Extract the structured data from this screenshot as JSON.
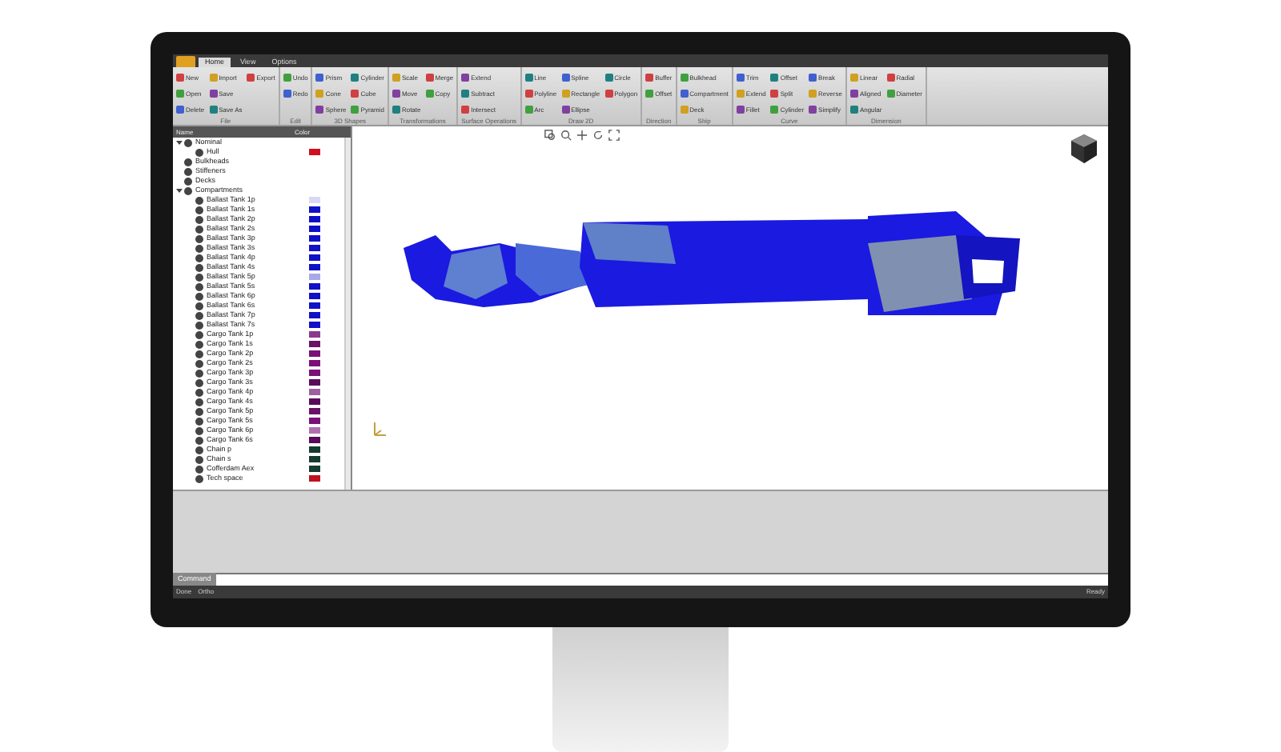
{
  "ribbon": {
    "tabs": [
      {
        "label": "Home",
        "selected": true
      },
      {
        "label": "View",
        "selected": false
      },
      {
        "label": "Options",
        "selected": false
      }
    ],
    "groups": [
      {
        "name": "File",
        "buttons": [
          "New",
          "Open",
          "Delete",
          "Import",
          "Save",
          "Save As",
          "Export"
        ]
      },
      {
        "name": "Edit",
        "buttons": [
          "Undo",
          "Redo"
        ]
      },
      {
        "name": "3D Shapes",
        "buttons": [
          "Prism",
          "Cone",
          "Sphere",
          "Cylinder",
          "Cube",
          "Pyramid"
        ]
      },
      {
        "name": "Transformations",
        "buttons": [
          "Scale",
          "Move",
          "Rotate",
          "Merge",
          "Copy"
        ]
      },
      {
        "name": "Surface Operations",
        "buttons": [
          "Extend",
          "Subtract",
          "Intersect"
        ]
      },
      {
        "name": "Draw 2D",
        "buttons": [
          "Line",
          "Polyline",
          "Arc",
          "Spline",
          "Rectangle",
          "Ellipse",
          "Circle",
          "Polygon"
        ]
      },
      {
        "name": "Direction",
        "buttons": [
          "Buffer",
          "Offset"
        ]
      },
      {
        "name": "Ship",
        "buttons": [
          "Bulkhead",
          "Compartment",
          "Deck"
        ]
      },
      {
        "name": "Curve",
        "buttons": [
          "Trim",
          "Extend",
          "Fillet",
          "Offset",
          "Split",
          "Cylinder",
          "Break",
          "Reverse",
          "Simplify"
        ]
      },
      {
        "name": "Dimension",
        "buttons": [
          "Linear",
          "Aligned",
          "Angular",
          "Radial",
          "Diameter"
        ]
      }
    ]
  },
  "tree": {
    "columns": [
      "Name",
      "Color"
    ],
    "items": [
      {
        "label": "Nominal",
        "expanded": true,
        "children": [
          {
            "label": "Hull",
            "color": "#d01020"
          }
        ]
      },
      {
        "label": "Bulkheads"
      },
      {
        "label": "Stiffeners"
      },
      {
        "label": "Decks"
      },
      {
        "label": "Compartments",
        "expanded": true,
        "children": [
          {
            "label": "Ballast Tank 1p",
            "color": "#d8d8f4"
          },
          {
            "label": "Ballast Tank 1s",
            "color": "#1010c8"
          },
          {
            "label": "Ballast Tank 2p",
            "color": "#1010c8"
          },
          {
            "label": "Ballast Tank 2s",
            "color": "#1010c8"
          },
          {
            "label": "Ballast Tank 3p",
            "color": "#1010c8"
          },
          {
            "label": "Ballast Tank 3s",
            "color": "#1010c8"
          },
          {
            "label": "Ballast Tank 4p",
            "color": "#1010c8"
          },
          {
            "label": "Ballast Tank 4s",
            "color": "#1010c8"
          },
          {
            "label": "Ballast Tank 5p",
            "color": "#a8a8e8"
          },
          {
            "label": "Ballast Tank 5s",
            "color": "#1010c8"
          },
          {
            "label": "Ballast Tank 6p",
            "color": "#1010c8"
          },
          {
            "label": "Ballast Tank 6s",
            "color": "#1010c8"
          },
          {
            "label": "Ballast Tank 7p",
            "color": "#1010c8"
          },
          {
            "label": "Ballast Tank 7s",
            "color": "#1010c8"
          },
          {
            "label": "Cargo Tank 1p",
            "color": "#8a3a8a"
          },
          {
            "label": "Cargo Tank 1s",
            "color": "#6a106a"
          },
          {
            "label": "Cargo Tank 2p",
            "color": "#7a107a"
          },
          {
            "label": "Cargo Tank 2s",
            "color": "#7a107a"
          },
          {
            "label": "Cargo Tank 3p",
            "color": "#7a107a"
          },
          {
            "label": "Cargo Tank 3s",
            "color": "#5a0a5a"
          },
          {
            "label": "Cargo Tank 4p",
            "color": "#a060a0"
          },
          {
            "label": "Cargo Tank 4s",
            "color": "#5a0a5a"
          },
          {
            "label": "Cargo Tank 5p",
            "color": "#6a106a"
          },
          {
            "label": "Cargo Tank 5s",
            "color": "#7a107a"
          },
          {
            "label": "Cargo Tank 6p",
            "color": "#b070b0"
          },
          {
            "label": "Cargo Tank 6s",
            "color": "#5a0a5a"
          },
          {
            "label": "Chain p",
            "color": "#143c30"
          },
          {
            "label": "Chain s",
            "color": "#143c30"
          },
          {
            "label": "Cofferdam Aex",
            "color": "#143c30"
          },
          {
            "label": "Tech space",
            "color": "#c01020"
          }
        ]
      }
    ]
  },
  "bottom_tab": "Command",
  "status": {
    "left": [
      "Done",
      "Ortho"
    ],
    "right": "Ready"
  }
}
